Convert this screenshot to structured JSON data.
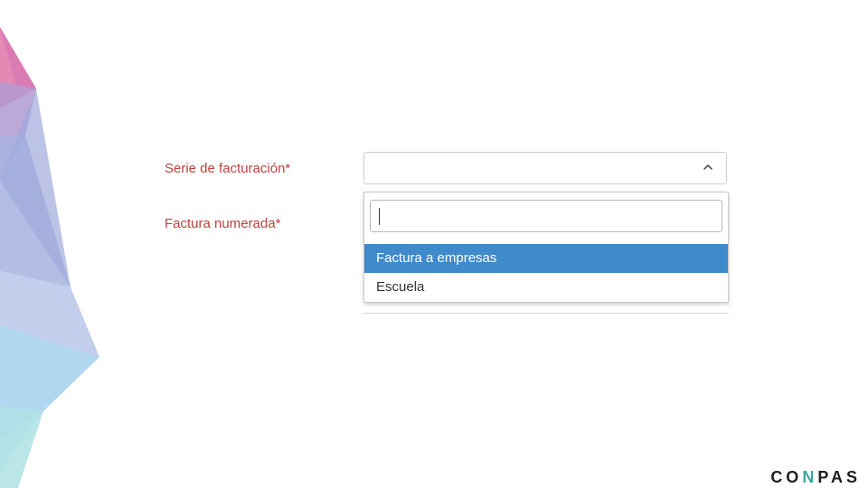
{
  "form": {
    "serie_label": "Serie de facturación*",
    "factura_label": "Factura numerada*"
  },
  "dropdown": {
    "search_value": "",
    "options": [
      {
        "label": "Factura a empresas",
        "selected": true
      },
      {
        "label": "Escuela",
        "selected": false
      }
    ]
  },
  "brand": {
    "logo_prefix": "CO",
    "logo_accent": "N",
    "logo_suffix": "PAS",
    "accent_color": "#3aa89b"
  },
  "colors": {
    "label": "#c0413c",
    "option_highlight": "#3f8acb"
  },
  "icons": {
    "select_toggle": "chevron-up-icon"
  }
}
